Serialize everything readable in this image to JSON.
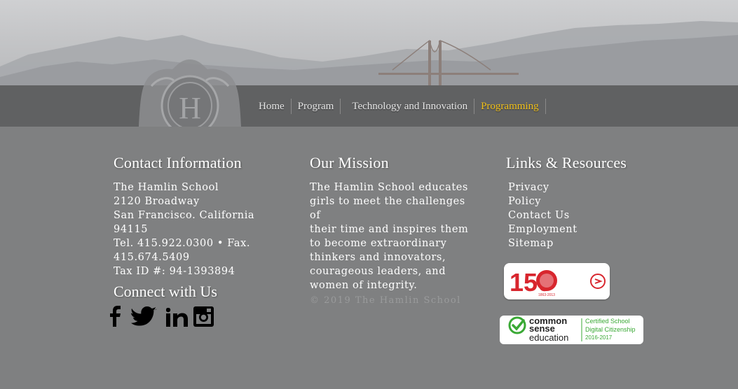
{
  "nav": {
    "items": [
      {
        "label": "Home"
      },
      {
        "label": "Program"
      },
      {
        "label": "Technology and Innovation"
      },
      {
        "label": "Programming"
      }
    ]
  },
  "contact": {
    "heading": "Contact Information",
    "lines": [
      "The Hamlin School",
      "2120 Broadway",
      "San Francisco. California",
      "94115",
      "Tel. 415.922.0300 • Fax.",
      "415.674.5409",
      "Tax ID #: 94-1393894"
    ]
  },
  "mission": {
    "heading": "Our Mission",
    "lines": [
      "The Hamlin School educates",
      "girls to meet the challenges of",
      "their time and inspires them",
      "to become extraordinary",
      "thinkers and innovators,",
      "courageous leaders, and",
      "women of integrity."
    ],
    "copyright": "© 2019 The Hamlin School"
  },
  "links": {
    "heading": "Links & Resources",
    "items": [
      "Privacy",
      "Policy",
      "Contact Us",
      "Employment",
      "Sitemap"
    ]
  },
  "connect": {
    "heading": "Connect with Us",
    "icons": [
      "facebook-icon",
      "twitter-icon",
      "linkedin-icon",
      "instagram-icon"
    ]
  },
  "badges": {
    "anniversary": {
      "number": "150",
      "years": "1863-2013"
    },
    "common_sense": {
      "brand_line1": "common",
      "brand_line2": "sense",
      "brand_line3": "education",
      "cert_line1": "Certified School",
      "cert_line2": "Digital Citizenship",
      "cert_line3": "2016-2017"
    }
  },
  "logo": {
    "letter": "H"
  },
  "colors": {
    "active_nav": "#f2c11b",
    "badge_red": "#d8262e",
    "common_sense_green": "#3aa935"
  }
}
